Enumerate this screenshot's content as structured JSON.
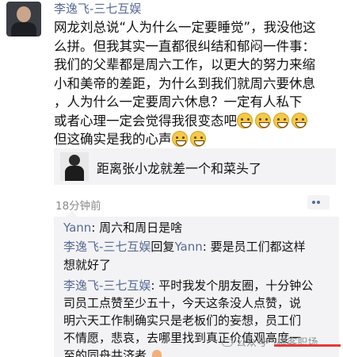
{
  "post": {
    "author": "李逸飞-三七互娱",
    "lines": [
      "网龙刘总说“人为什么一定要睡觉”，我没他这",
      "么拼。但我其实一直都很纠结和郁闷一件事：",
      "我们的父辈都是周六工作，以更大的努力来缩",
      "小和美帝的差距，为什么到我们就周六要休息",
      "，人为什么一定要周六休息？一定有人私下",
      "或者心理一定会觉得我很变态吧",
      "但这确实是我的心声"
    ],
    "emoji_line6": [
      "grin-emoji",
      "grin-emoji",
      "grin-emoji",
      "grin-emoji"
    ],
    "emoji_line7": [
      "grin-emoji",
      "grin-emoji"
    ]
  },
  "shared_link": {
    "title": "距离张小龙就差一个和菜头了"
  },
  "timestamp": "18分钟前",
  "comments": [
    {
      "author": "Yann",
      "sep": ": ",
      "text": "周六和周日是啥"
    },
    {
      "author": "李逸飞-三七互娱",
      "reply_word": "回复",
      "reply_to": "Yann",
      "sep": ": ",
      "text_lines": [
        "要是员工们都这样",
        "想就好了"
      ]
    },
    {
      "author": "李逸飞-三七互娱",
      "sep": ": ",
      "text_lines": [
        "平时我发个朋友圈，十分钟公",
        "司员工点赞至少五十，今天这条没人点赞，说",
        "明六天工作制确实只是老板们的妄想，员工们",
        "不情愿，悲哀，去哪里找到真正价值观高度一",
        "至的同舟共济者"
      ]
    }
  ],
  "watermark": {
    "text": "公众号 · 极客职场"
  },
  "colors": {
    "link_blue": "#576b95",
    "comment_bg": "#f3f3f5",
    "time_gray": "#8a8a8a",
    "underline_red": "#e53935"
  }
}
